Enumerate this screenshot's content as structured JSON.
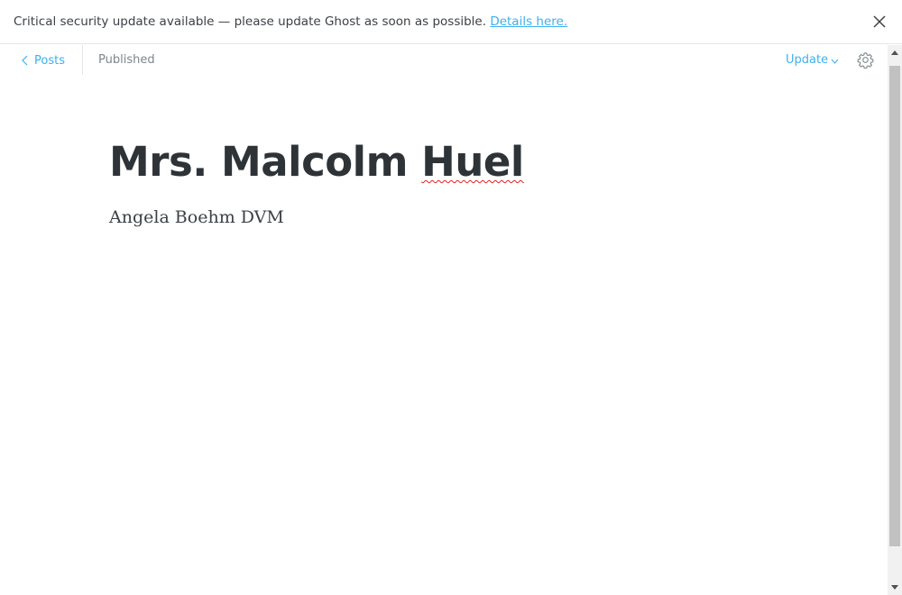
{
  "alert": {
    "message": "Critical security update available — please update Ghost as soon as possible.",
    "link_text": "Details here.",
    "close_icon": "close-icon"
  },
  "editor_nav": {
    "back_label": "Posts",
    "status": "Published",
    "update_label": "Update",
    "settings_icon": "gear-icon"
  },
  "post": {
    "title_part1": "Mrs. Malcolm ",
    "title_part2": "Huel",
    "body": "Angela Boehm DVM"
  },
  "colors": {
    "accent": "#3eb0ef",
    "title": "#2e3338",
    "muted": "#7d878a"
  }
}
